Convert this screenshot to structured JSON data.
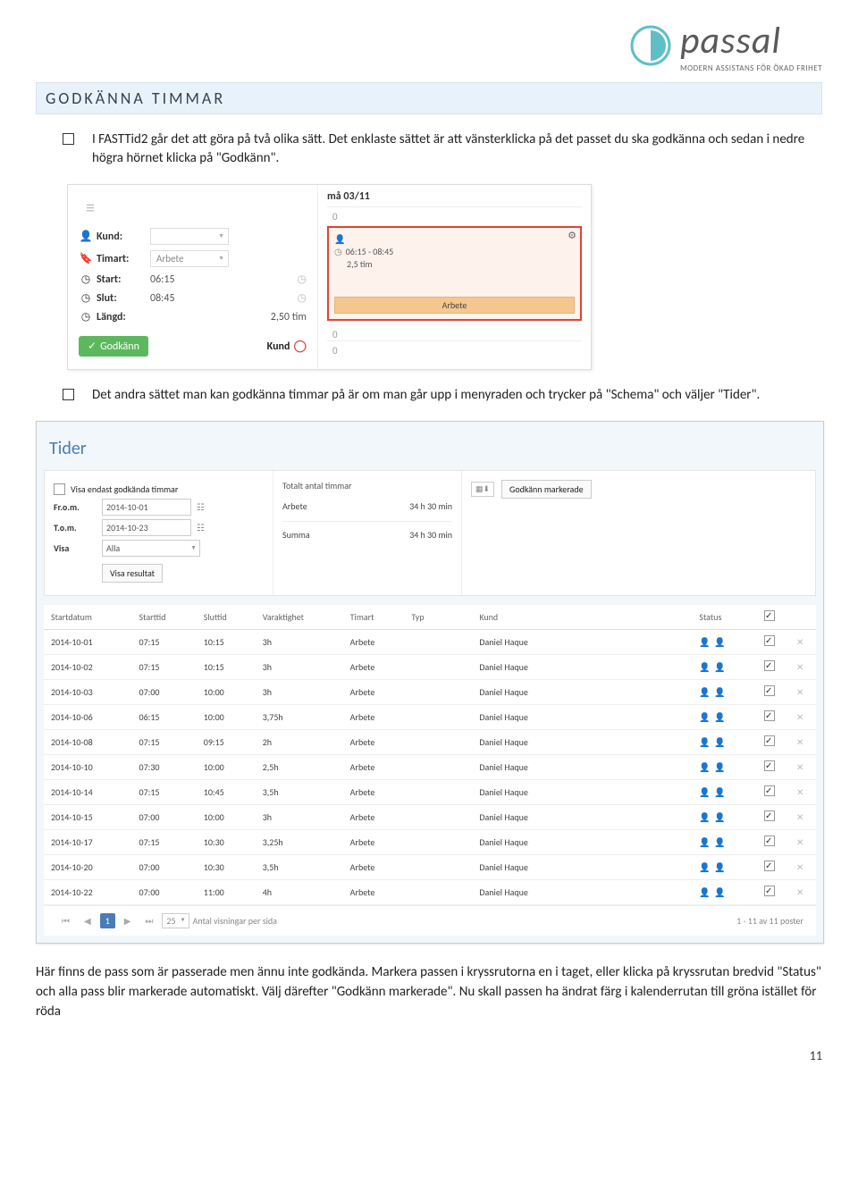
{
  "logo": {
    "main": "passal",
    "sub": "MODERN ASSISTANS FÖR ÖKAD FRIHET"
  },
  "section_title": "GODKÄNNA TIMMAR",
  "para1": "I FASTTid2 går det att göra på två olika sätt. Det enklaste sättet är att vänsterklicka på det passet du ska godkänna och sedan i nedre högra hörnet klicka på \"Godkänn\".",
  "ss1": {
    "day": "må 03/11",
    "kund_label": "Kund:",
    "timart_label": "Timart:",
    "timart_val": "Arbete",
    "start_label": "Start:",
    "start_val": "06:15",
    "slut_label": "Slut:",
    "slut_val": "08:45",
    "langd_label": "Längd:",
    "langd_val": "2,50 tim",
    "approve": "Godkänn",
    "kund_btn": "Kund",
    "card_time": "06:15 - 08:45",
    "card_dur": "2,5 tim",
    "card_label": "Arbete"
  },
  "para2": "Det andra sättet man kan godkänna timmar på är om man går upp i menyraden och trycker på \"Schema\" och väljer \"Tider\".",
  "ss2": {
    "title": "Tider",
    "only_approved": "Visa endast godkända timmar",
    "from_label": "Fr.o.m.",
    "from_val": "2014-10-01",
    "to_label": "T.o.m.",
    "to_val": "2014-10-23",
    "show_label": "Visa",
    "show_val": "Alla",
    "show_results": "Visa resultat",
    "total_title": "Totalt antal timmar",
    "total_arbete_label": "Arbete",
    "total_arbete_val": "34 h 30 min",
    "total_sum_label": "Summa",
    "total_sum_val": "34 h 30 min",
    "approve_marked": "Godkänn markerade",
    "headers": {
      "startdatum": "Startdatum",
      "starttid": "Starttid",
      "sluttid": "Sluttid",
      "varaktighet": "Varaktighet",
      "timart": "Timart",
      "typ": "Typ",
      "kund": "Kund",
      "status": "Status"
    },
    "rows": [
      {
        "d": "2014-10-01",
        "s": "07:15",
        "e": "10:15",
        "v": "3h",
        "t": "Arbete",
        "k": "Daniel Haque",
        "c": true
      },
      {
        "d": "2014-10-02",
        "s": "07:15",
        "e": "10:15",
        "v": "3h",
        "t": "Arbete",
        "k": "Daniel Haque",
        "c": true
      },
      {
        "d": "2014-10-03",
        "s": "07:00",
        "e": "10:00",
        "v": "3h",
        "t": "Arbete",
        "k": "Daniel Haque",
        "c": true
      },
      {
        "d": "2014-10-06",
        "s": "06:15",
        "e": "10:00",
        "v": "3,75h",
        "t": "Arbete",
        "k": "Daniel Haque",
        "c": true
      },
      {
        "d": "2014-10-08",
        "s": "07:15",
        "e": "09:15",
        "v": "2h",
        "t": "Arbete",
        "k": "Daniel Haque",
        "c": true
      },
      {
        "d": "2014-10-10",
        "s": "07:30",
        "e": "10:00",
        "v": "2,5h",
        "t": "Arbete",
        "k": "Daniel Haque",
        "c": true
      },
      {
        "d": "2014-10-14",
        "s": "07:15",
        "e": "10:45",
        "v": "3,5h",
        "t": "Arbete",
        "k": "Daniel Haque",
        "c": true
      },
      {
        "d": "2014-10-15",
        "s": "07:00",
        "e": "10:00",
        "v": "3h",
        "t": "Arbete",
        "k": "Daniel Haque",
        "c": true
      },
      {
        "d": "2014-10-17",
        "s": "07:15",
        "e": "10:30",
        "v": "3,25h",
        "t": "Arbete",
        "k": "Daniel Haque",
        "c": true
      },
      {
        "d": "2014-10-20",
        "s": "07:00",
        "e": "10:30",
        "v": "3,5h",
        "t": "Arbete",
        "k": "Daniel Haque",
        "c": true
      },
      {
        "d": "2014-10-22",
        "s": "07:00",
        "e": "11:00",
        "v": "4h",
        "t": "Arbete",
        "k": "Daniel Haque",
        "c": true
      }
    ],
    "per_page": "25",
    "per_page_label": "Antal visningar per sida",
    "pager_info": "1 - 11 av 11 poster"
  },
  "para3": "Här finns de pass som är passerade men ännu inte godkända. Markera passen i kryssrutorna en i taget, eller klicka på kryssrutan bredvid \"Status\" och alla pass blir markerade automatiskt. Välj därefter \"Godkänn markerade\". Nu skall passen ha ändrat färg i kalenderrutan till gröna istället för röda",
  "page_num": "11"
}
